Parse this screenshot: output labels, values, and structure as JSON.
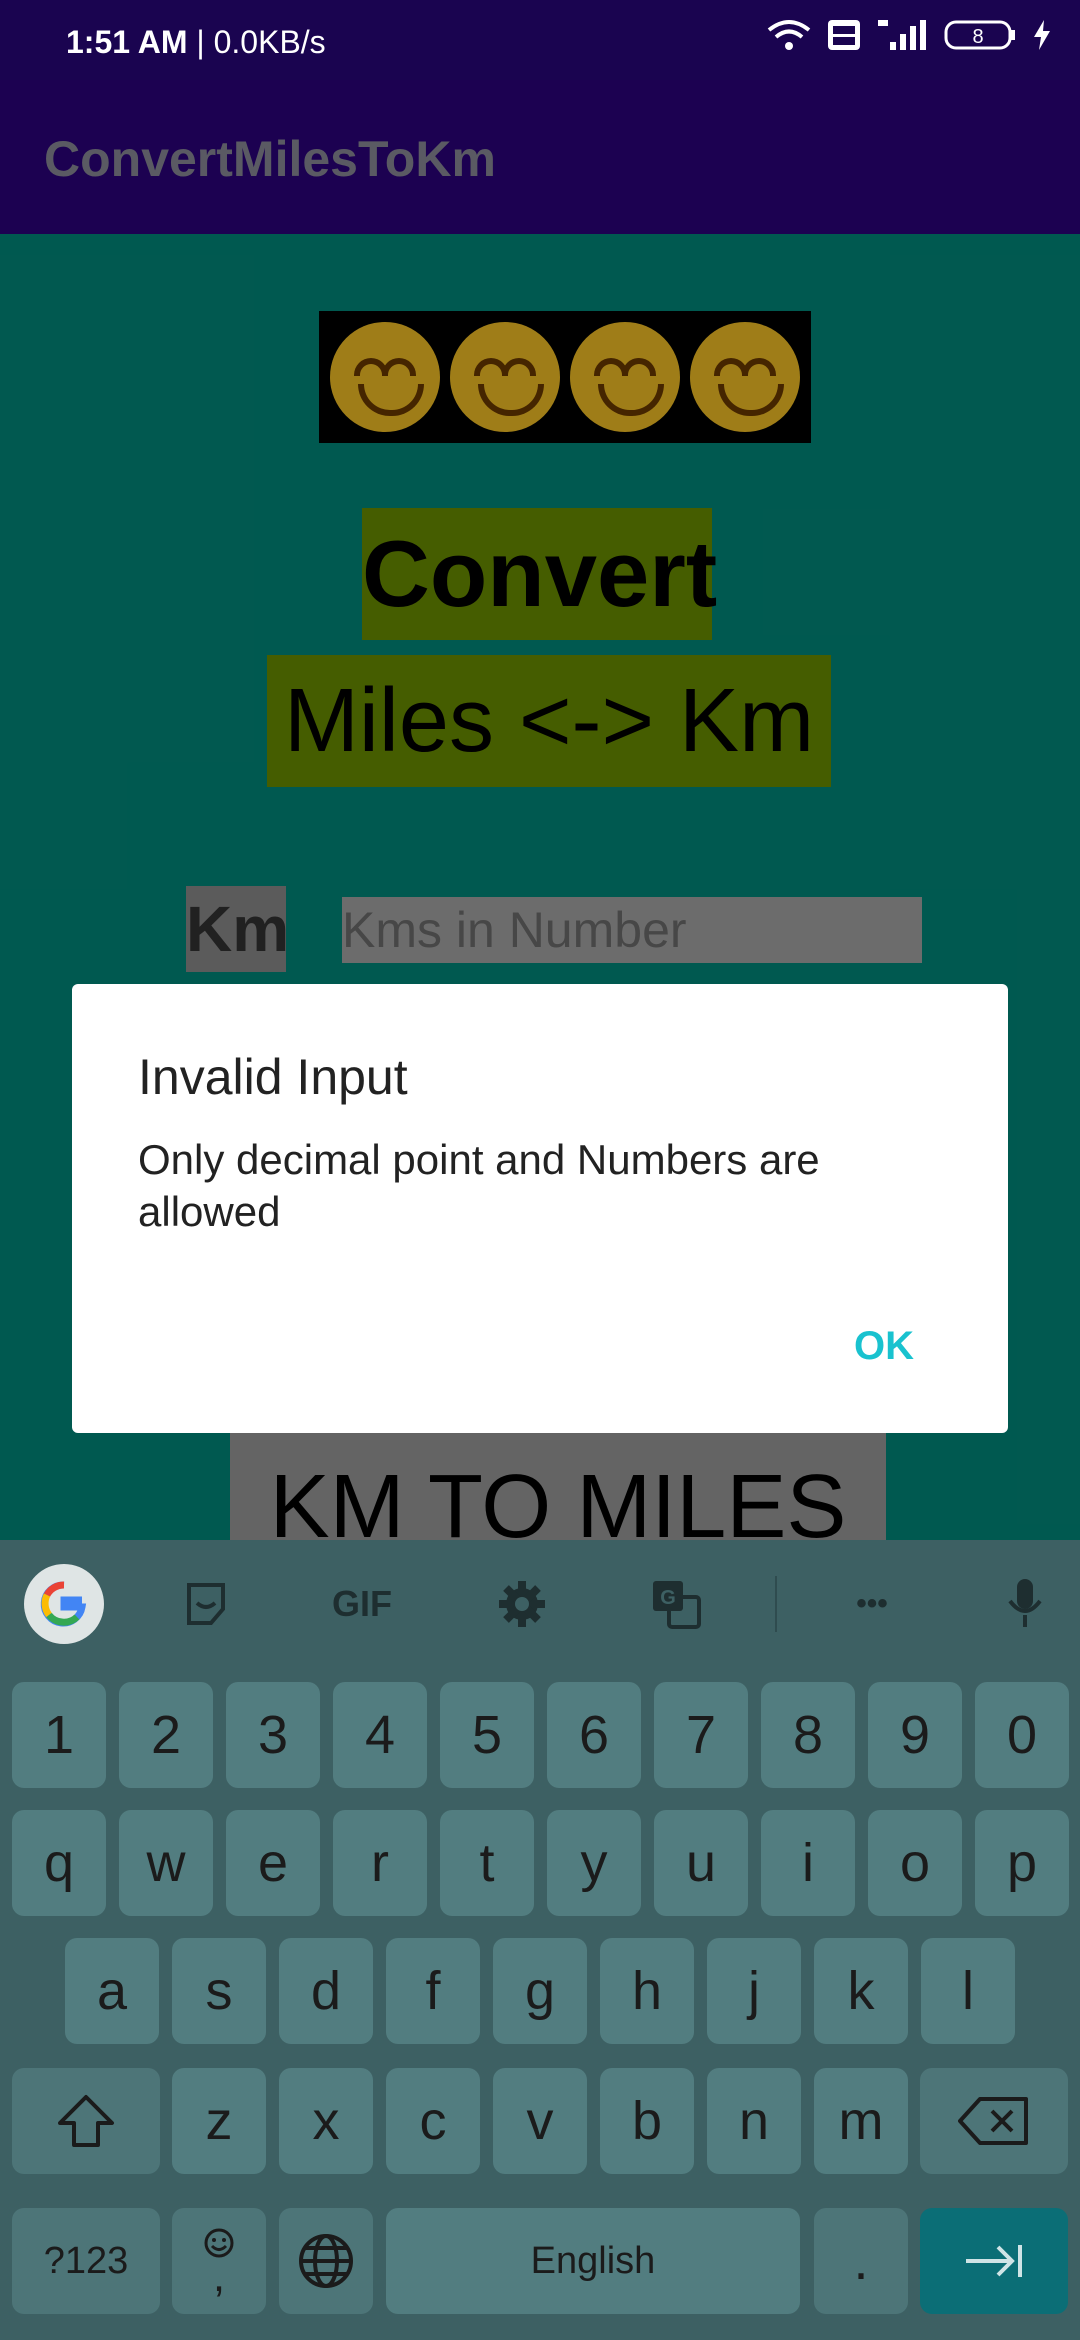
{
  "status_bar": {
    "time": "1:51 AM",
    "speed": "| 0.0KB/s",
    "battery": "8"
  },
  "app": {
    "title": "ConvertMilesToKm"
  },
  "content": {
    "convert_text": "Convert",
    "miles_km_text": "Miles <-> Km",
    "km_label": "Km",
    "km_input_placeholder": "Kms in Number",
    "km_to_miles_button": "KM TO MILES"
  },
  "dialog": {
    "title": "Invalid Input",
    "message": "Only decimal point and Numbers are allowed",
    "ok_button": "OK"
  },
  "keyboard": {
    "toolbar": {
      "gif": "GIF",
      "more": "•••"
    },
    "row_numbers": [
      "1",
      "2",
      "3",
      "4",
      "5",
      "6",
      "7",
      "8",
      "9",
      "0"
    ],
    "row_1": [
      "q",
      "w",
      "e",
      "r",
      "t",
      "y",
      "u",
      "i",
      "o",
      "p"
    ],
    "row_2": [
      "a",
      "s",
      "d",
      "f",
      "g",
      "h",
      "j",
      "k",
      "l"
    ],
    "row_3": [
      "z",
      "x",
      "c",
      "v",
      "b",
      "n",
      "m"
    ],
    "sym_key": "?123",
    "emoji_comma_key": ",",
    "space_label": "English",
    "period_key": "."
  },
  "colors": {
    "toolbar": "#2c037d",
    "status_bar": "#1a0450",
    "content_bg": "#01897b",
    "keyboard_bg": "#3d6063",
    "dialog_ok": "#19c2cf"
  }
}
